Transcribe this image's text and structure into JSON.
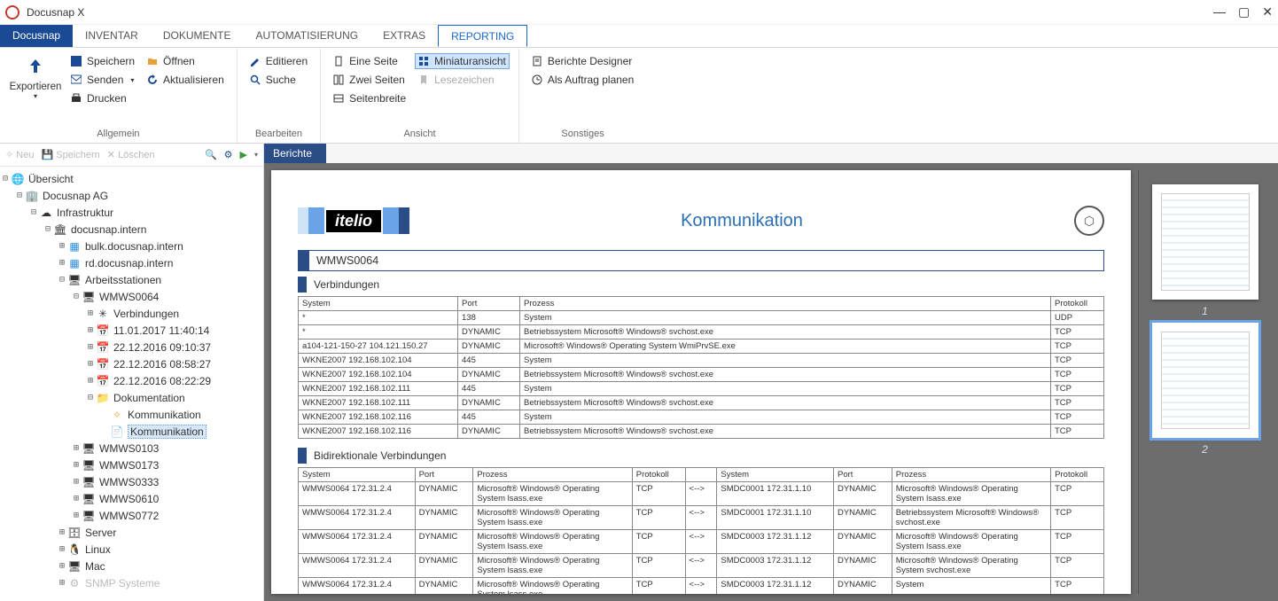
{
  "app": {
    "title": "Docusnap X"
  },
  "menu": {
    "file": "Docusnap",
    "tabs": [
      "INVENTAR",
      "DOKUMENTE",
      "AUTOMATISIERUNG",
      "EXTRAS",
      "REPORTING"
    ],
    "active_index": 4
  },
  "ribbon": {
    "groups": {
      "allgemein": {
        "label": "Allgemein",
        "export": "Exportieren",
        "save": "Speichern",
        "open": "Öffnen",
        "send": "Senden",
        "refresh": "Aktualisieren",
        "print": "Drucken"
      },
      "bearbeiten": {
        "label": "Bearbeiten",
        "edit": "Editieren",
        "search": "Suche"
      },
      "ansicht": {
        "label": "Ansicht",
        "one_page": "Eine Seite",
        "two_pages": "Zwei Seiten",
        "page_width": "Seitenbreite",
        "thumbnails": "Miniaturansicht",
        "bookmark": "Lesezeichen"
      },
      "sonstiges": {
        "label": "Sonstiges",
        "designer": "Berichte Designer",
        "schedule": "Als Auftrag planen"
      }
    }
  },
  "tree_toolbar": {
    "new": "Neu",
    "save": "Speichern",
    "delete": "Löschen"
  },
  "tree": {
    "root": "Übersicht",
    "company": "Docusnap AG",
    "infra": "Infrastruktur",
    "domain": "docusnap.intern",
    "sites": [
      "bulk.docusnap.intern",
      "rd.docusnap.intern"
    ],
    "workstations": "Arbeitsstationen",
    "ws_selected": "WMWS0064",
    "connections": "Verbindungen",
    "snapshots": [
      "11.01.2017 11:40:14",
      "22.12.2016 09:10:37",
      "22.12.2016 08:58:27",
      "22.12.2016 08:22:29"
    ],
    "documentation": "Dokumentation",
    "doc_items": [
      "Kommunikation",
      "Kommunikation"
    ],
    "other_ws": [
      "WMWS0103",
      "WMWS0173",
      "WMWS0333",
      "WMWS0610",
      "WMWS0772"
    ],
    "server": "Server",
    "linux": "Linux",
    "mac": "Mac",
    "snmp": "SNMP Systeme"
  },
  "report": {
    "tab": "Berichte",
    "title": "Kommunikation",
    "device": "WMWS0064",
    "section_connections": "Verbindungen",
    "section_bidi": "Bidirektionale Verbindungen",
    "headers1": [
      "System",
      "Port",
      "Prozess",
      "Protokoll"
    ],
    "rows1": [
      [
        "*",
        "138",
        "System",
        "UDP"
      ],
      [
        "*",
        "DYNAMIC",
        "Betriebssystem Microsoft® Windows® svchost.exe",
        "TCP"
      ],
      [
        "a104-121-150-27 104.121.150.27",
        "DYNAMIC",
        "Microsoft® Windows® Operating System WmiPrvSE.exe",
        "TCP"
      ],
      [
        "WKNE2007 192.168.102.104",
        "445",
        "System",
        "TCP"
      ],
      [
        "WKNE2007 192.168.102.104",
        "DYNAMIC",
        "Betriebssystem Microsoft® Windows® svchost.exe",
        "TCP"
      ],
      [
        "WKNE2007 192.168.102.111",
        "445",
        "System",
        "TCP"
      ],
      [
        "WKNE2007 192.168.102.111",
        "DYNAMIC",
        "Betriebssystem Microsoft® Windows® svchost.exe",
        "TCP"
      ],
      [
        "WKNE2007 192.168.102.116",
        "445",
        "System",
        "TCP"
      ],
      [
        "WKNE2007 192.168.102.116",
        "DYNAMIC",
        "Betriebssystem Microsoft® Windows® svchost.exe",
        "TCP"
      ]
    ],
    "headers2": [
      "System",
      "Port",
      "Prozess",
      "Protokoll",
      "",
      "System",
      "Port",
      "Prozess",
      "Protokoll"
    ],
    "rows2": [
      [
        "WMWS0064 172.31.2.4",
        "DYNAMIC",
        "Microsoft® Windows® Operating System lsass.exe",
        "TCP",
        "<-->",
        "SMDC0001 172.31.1.10",
        "DYNAMIC",
        "Microsoft® Windows® Operating System lsass.exe",
        "TCP"
      ],
      [
        "WMWS0064 172.31.2.4",
        "DYNAMIC",
        "Microsoft® Windows® Operating System lsass.exe",
        "TCP",
        "<-->",
        "SMDC0001 172.31.1.10",
        "DYNAMIC",
        "Betriebssystem Microsoft® Windows® svchost.exe",
        "TCP"
      ],
      [
        "WMWS0064 172.31.2.4",
        "DYNAMIC",
        "Microsoft® Windows® Operating System lsass.exe",
        "TCP",
        "<-->",
        "SMDC0003 172.31.1.12",
        "DYNAMIC",
        "Microsoft® Windows® Operating System lsass.exe",
        "TCP"
      ],
      [
        "WMWS0064 172.31.2.4",
        "DYNAMIC",
        "Microsoft® Windows® Operating System lsass.exe",
        "TCP",
        "<-->",
        "SMDC0003 172.31.1.12",
        "DYNAMIC",
        "Microsoft® Windows® Operating System svchost.exe",
        "TCP"
      ],
      [
        "WMWS0064 172.31.2.4",
        "DYNAMIC",
        "Microsoft® Windows® Operating System lsass.exe",
        "TCP",
        "<-->",
        "SMDC0003 172.31.1.12",
        "DYNAMIC",
        "System",
        "TCP"
      ]
    ]
  },
  "thumbs": {
    "pages": [
      "1",
      "2"
    ],
    "selected": 1
  }
}
